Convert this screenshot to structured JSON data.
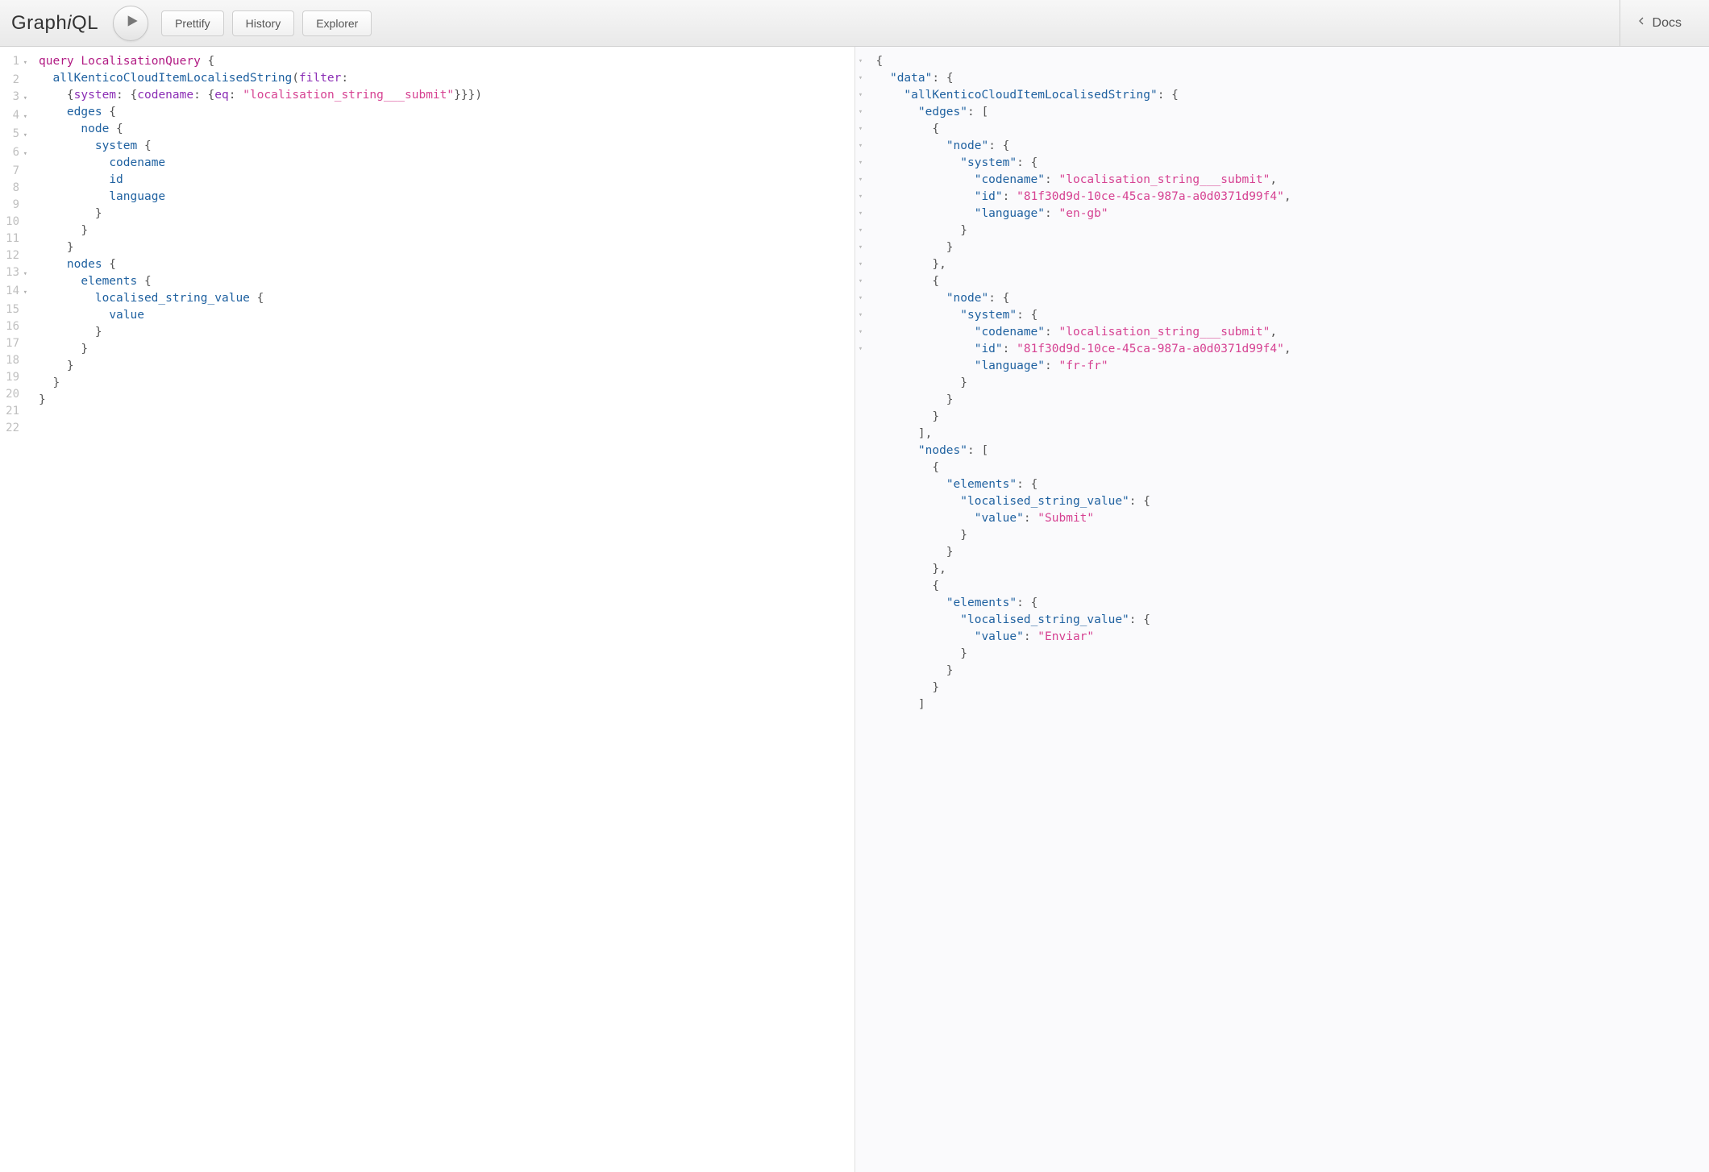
{
  "app": {
    "title_parts": [
      "Graph",
      "i",
      "QL"
    ]
  },
  "toolbar": {
    "prettify": "Prettify",
    "history": "History",
    "explorer": "Explorer",
    "docs": "Docs"
  },
  "editor": {
    "line_count": 22,
    "fold_lines": [
      1,
      3,
      4,
      5,
      6,
      13,
      14
    ],
    "tokens": [
      [
        [
          "kw",
          "query"
        ],
        [
          "pun",
          " "
        ],
        [
          "def",
          "LocalisationQuery"
        ],
        [
          "pun",
          " {"
        ]
      ],
      [
        [
          "pun",
          "  "
        ],
        [
          "name",
          "allKenticoCloudItemLocalisedString"
        ],
        [
          "pun",
          "("
        ],
        [
          "attr",
          "filter"
        ],
        [
          "pun",
          ":"
        ]
      ],
      [
        [
          "pun",
          "    {"
        ],
        [
          "attr",
          "system"
        ],
        [
          "pun",
          ": {"
        ],
        [
          "attr",
          "codename"
        ],
        [
          "pun",
          ": {"
        ],
        [
          "attr",
          "eq"
        ],
        [
          "pun",
          ": "
        ],
        [
          "str",
          "\"localisation_string___submit\""
        ],
        [
          "pun",
          "}}})"
        ]
      ],
      [
        [
          "pun",
          "    "
        ],
        [
          "name",
          "edges"
        ],
        [
          "pun",
          " {"
        ]
      ],
      [
        [
          "pun",
          "      "
        ],
        [
          "name",
          "node"
        ],
        [
          "pun",
          " {"
        ]
      ],
      [
        [
          "pun",
          "        "
        ],
        [
          "name",
          "system"
        ],
        [
          "pun",
          " {"
        ]
      ],
      [
        [
          "pun",
          "          "
        ],
        [
          "name",
          "codename"
        ]
      ],
      [
        [
          "pun",
          "          "
        ],
        [
          "name",
          "id"
        ]
      ],
      [
        [
          "pun",
          "          "
        ],
        [
          "name",
          "language"
        ]
      ],
      [
        [
          "pun",
          "        }"
        ]
      ],
      [
        [
          "pun",
          "      }"
        ]
      ],
      [
        [
          "pun",
          "    }"
        ]
      ],
      [
        [
          "pun",
          "    "
        ],
        [
          "name",
          "nodes"
        ],
        [
          "pun",
          " {"
        ]
      ],
      [
        [
          "pun",
          "      "
        ],
        [
          "name",
          "elements"
        ],
        [
          "pun",
          " {"
        ]
      ],
      [
        [
          "pun",
          "        "
        ],
        [
          "name",
          "localised_string_value"
        ],
        [
          "pun",
          " {"
        ]
      ],
      [
        [
          "pun",
          "          "
        ],
        [
          "name",
          "value"
        ]
      ],
      [
        [
          "pun",
          "        }"
        ]
      ],
      [
        [
          "pun",
          "      }"
        ]
      ],
      [
        [
          "pun",
          "    }"
        ]
      ],
      [
        [
          "pun",
          "  }"
        ]
      ],
      [
        [
          "pun",
          "}"
        ]
      ],
      [
        [
          "pun",
          ""
        ]
      ]
    ]
  },
  "result": {
    "fold_lines": [
      1,
      2,
      3,
      4,
      5,
      6,
      7,
      8,
      14,
      15,
      16,
      25,
      26,
      27,
      28,
      33,
      34,
      35
    ],
    "tokens": [
      [
        [
          "pun",
          "{"
        ]
      ],
      [
        [
          "pun",
          "  "
        ],
        [
          "jkey",
          "\"data\""
        ],
        [
          "pun",
          ": {"
        ]
      ],
      [
        [
          "pun",
          "    "
        ],
        [
          "jkey",
          "\"allKenticoCloudItemLocalisedString\""
        ],
        [
          "pun",
          ": {"
        ]
      ],
      [
        [
          "pun",
          "      "
        ],
        [
          "jkey",
          "\"edges\""
        ],
        [
          "pun",
          ": ["
        ]
      ],
      [
        [
          "pun",
          "        {"
        ]
      ],
      [
        [
          "pun",
          "          "
        ],
        [
          "jkey",
          "\"node\""
        ],
        [
          "pun",
          ": {"
        ]
      ],
      [
        [
          "pun",
          "            "
        ],
        [
          "jkey",
          "\"system\""
        ],
        [
          "pun",
          ": {"
        ]
      ],
      [
        [
          "pun",
          "              "
        ],
        [
          "jkey",
          "\"codename\""
        ],
        [
          "pun",
          ": "
        ],
        [
          "jstr",
          "\"localisation_string___submit\""
        ],
        [
          "pun",
          ","
        ]
      ],
      [
        [
          "pun",
          "              "
        ],
        [
          "jkey",
          "\"id\""
        ],
        [
          "pun",
          ": "
        ],
        [
          "jstr",
          "\"81f30d9d-10ce-45ca-987a-a0d0371d99f4\""
        ],
        [
          "pun",
          ","
        ]
      ],
      [
        [
          "pun",
          "              "
        ],
        [
          "jkey",
          "\"language\""
        ],
        [
          "pun",
          ": "
        ],
        [
          "jstr",
          "\"en-gb\""
        ]
      ],
      [
        [
          "pun",
          "            }"
        ]
      ],
      [
        [
          "pun",
          "          }"
        ]
      ],
      [
        [
          "pun",
          "        },"
        ]
      ],
      [
        [
          "pun",
          "        {"
        ]
      ],
      [
        [
          "pun",
          "          "
        ],
        [
          "jkey",
          "\"node\""
        ],
        [
          "pun",
          ": {"
        ]
      ],
      [
        [
          "pun",
          "            "
        ],
        [
          "jkey",
          "\"system\""
        ],
        [
          "pun",
          ": {"
        ]
      ],
      [
        [
          "pun",
          "              "
        ],
        [
          "jkey",
          "\"codename\""
        ],
        [
          "pun",
          ": "
        ],
        [
          "jstr",
          "\"localisation_string___submit\""
        ],
        [
          "pun",
          ","
        ]
      ],
      [
        [
          "pun",
          "              "
        ],
        [
          "jkey",
          "\"id\""
        ],
        [
          "pun",
          ": "
        ],
        [
          "jstr",
          "\"81f30d9d-10ce-45ca-987a-a0d0371d99f4\""
        ],
        [
          "pun",
          ","
        ]
      ],
      [
        [
          "pun",
          "              "
        ],
        [
          "jkey",
          "\"language\""
        ],
        [
          "pun",
          ": "
        ],
        [
          "jstr",
          "\"fr-fr\""
        ]
      ],
      [
        [
          "pun",
          "            }"
        ]
      ],
      [
        [
          "pun",
          "          }"
        ]
      ],
      [
        [
          "pun",
          "        }"
        ]
      ],
      [
        [
          "pun",
          "      ],"
        ]
      ],
      [
        [
          "pun",
          "      "
        ],
        [
          "jkey",
          "\"nodes\""
        ],
        [
          "pun",
          ": ["
        ]
      ],
      [
        [
          "pun",
          "        {"
        ]
      ],
      [
        [
          "pun",
          "          "
        ],
        [
          "jkey",
          "\"elements\""
        ],
        [
          "pun",
          ": {"
        ]
      ],
      [
        [
          "pun",
          "            "
        ],
        [
          "jkey",
          "\"localised_string_value\""
        ],
        [
          "pun",
          ": {"
        ]
      ],
      [
        [
          "pun",
          "              "
        ],
        [
          "jkey",
          "\"value\""
        ],
        [
          "pun",
          ": "
        ],
        [
          "jstr",
          "\"Submit\""
        ]
      ],
      [
        [
          "pun",
          "            }"
        ]
      ],
      [
        [
          "pun",
          "          }"
        ]
      ],
      [
        [
          "pun",
          "        },"
        ]
      ],
      [
        [
          "pun",
          "        {"
        ]
      ],
      [
        [
          "pun",
          "          "
        ],
        [
          "jkey",
          "\"elements\""
        ],
        [
          "pun",
          ": {"
        ]
      ],
      [
        [
          "pun",
          "            "
        ],
        [
          "jkey",
          "\"localised_string_value\""
        ],
        [
          "pun",
          ": {"
        ]
      ],
      [
        [
          "pun",
          "              "
        ],
        [
          "jkey",
          "\"value\""
        ],
        [
          "pun",
          ": "
        ],
        [
          "jstr",
          "\"Enviar\""
        ]
      ],
      [
        [
          "pun",
          "            }"
        ]
      ],
      [
        [
          "pun",
          "          }"
        ]
      ],
      [
        [
          "pun",
          "        }"
        ]
      ],
      [
        [
          "pun",
          "      ]"
        ]
      ]
    ]
  }
}
